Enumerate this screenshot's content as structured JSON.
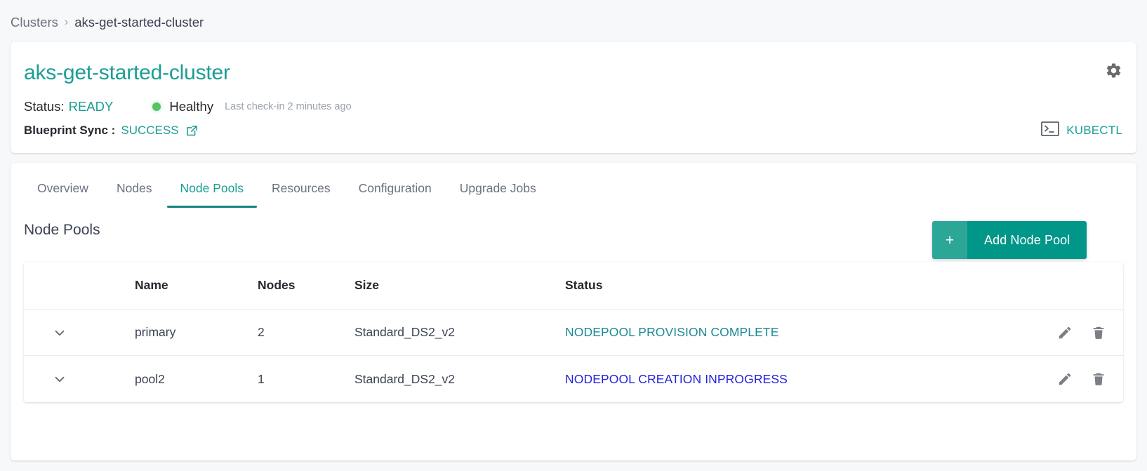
{
  "breadcrumb": {
    "root": "Clusters",
    "separator": "›",
    "current": "aks-get-started-cluster"
  },
  "summary": {
    "title": "aks-get-started-cluster",
    "status_label": "Status:",
    "status_value": "READY",
    "health_text": "Healthy",
    "health_dot_color": "#57c364",
    "checkin_text": "Last check-in 2 minutes ago",
    "sync_label": "Blueprint Sync :",
    "sync_value": "SUCCESS",
    "external_link_icon": "external-link-icon",
    "gear_icon": "gear-icon",
    "kubectl_icon": "terminal-icon",
    "kubectl_label": "KUBECTL",
    "accent_color": "#1b9e93"
  },
  "tabs": [
    {
      "label": "Overview",
      "active": false
    },
    {
      "label": "Nodes",
      "active": false
    },
    {
      "label": "Node Pools",
      "active": true
    },
    {
      "label": "Resources",
      "active": false
    },
    {
      "label": "Configuration",
      "active": false
    },
    {
      "label": "Upgrade Jobs",
      "active": false
    }
  ],
  "section": {
    "title": "Node Pools",
    "add_button_plus": "+",
    "add_button_label": "Add Node Pool",
    "add_button_color": "#009688"
  },
  "table": {
    "columns": [
      "",
      "Name",
      "Nodes",
      "Size",
      "Status",
      ""
    ],
    "rows": [
      {
        "expand_icon": "chevron-down-icon",
        "name": "primary",
        "nodes": "2",
        "size": "Standard_DS2_v2",
        "status": "NODEPOOL PROVISION COMPLETE",
        "status_color": "#1b8a94",
        "edit_icon": "pencil-icon",
        "delete_icon": "trash-icon"
      },
      {
        "expand_icon": "chevron-down-icon",
        "name": "pool2",
        "nodes": "1",
        "size": "Standard_DS2_v2",
        "status": "NODEPOOL CREATION INPROGRESS",
        "status_color": "#2222dd",
        "edit_icon": "pencil-icon",
        "delete_icon": "trash-icon"
      }
    ]
  }
}
